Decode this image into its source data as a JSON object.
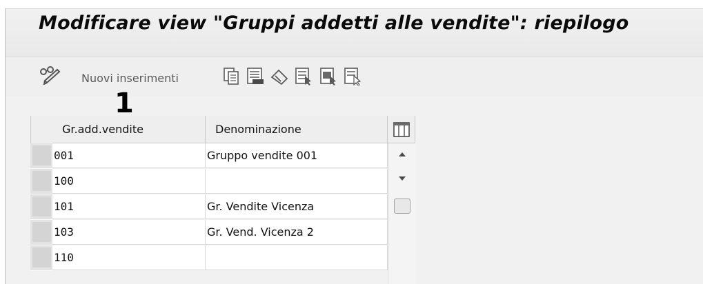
{
  "title": "Modificare view \"Gruppi addetti alle vendite\": riepilogo",
  "toolbar": {
    "new_entries_label": "Nuovi inserimenti"
  },
  "annotation": {
    "marker": "1"
  },
  "table": {
    "columns": [
      "Gr.add.vendite",
      "Denominazione"
    ],
    "rows": [
      {
        "code": "001",
        "name": "Gruppo vendite 001"
      },
      {
        "code": "100",
        "name": ""
      },
      {
        "code": "101",
        "name": "Gr. Vendite Vicenza"
      },
      {
        "code": "103",
        "name": "Gr. Vend. Vicenza 2"
      },
      {
        "code": "110",
        "name": ""
      }
    ]
  },
  "icons": {
    "toggle_edit": "glasses-pencil-icon",
    "copy": "copy-icon",
    "save": "save-icon",
    "undo": "undo-icon",
    "select_all": "select-all-icon",
    "select_block": "select-block-icon",
    "deselect_all": "deselect-all-icon",
    "table_settings": "table-settings-icon",
    "scroll_up": "scroll-up-icon",
    "scroll_down": "scroll-down-icon"
  }
}
